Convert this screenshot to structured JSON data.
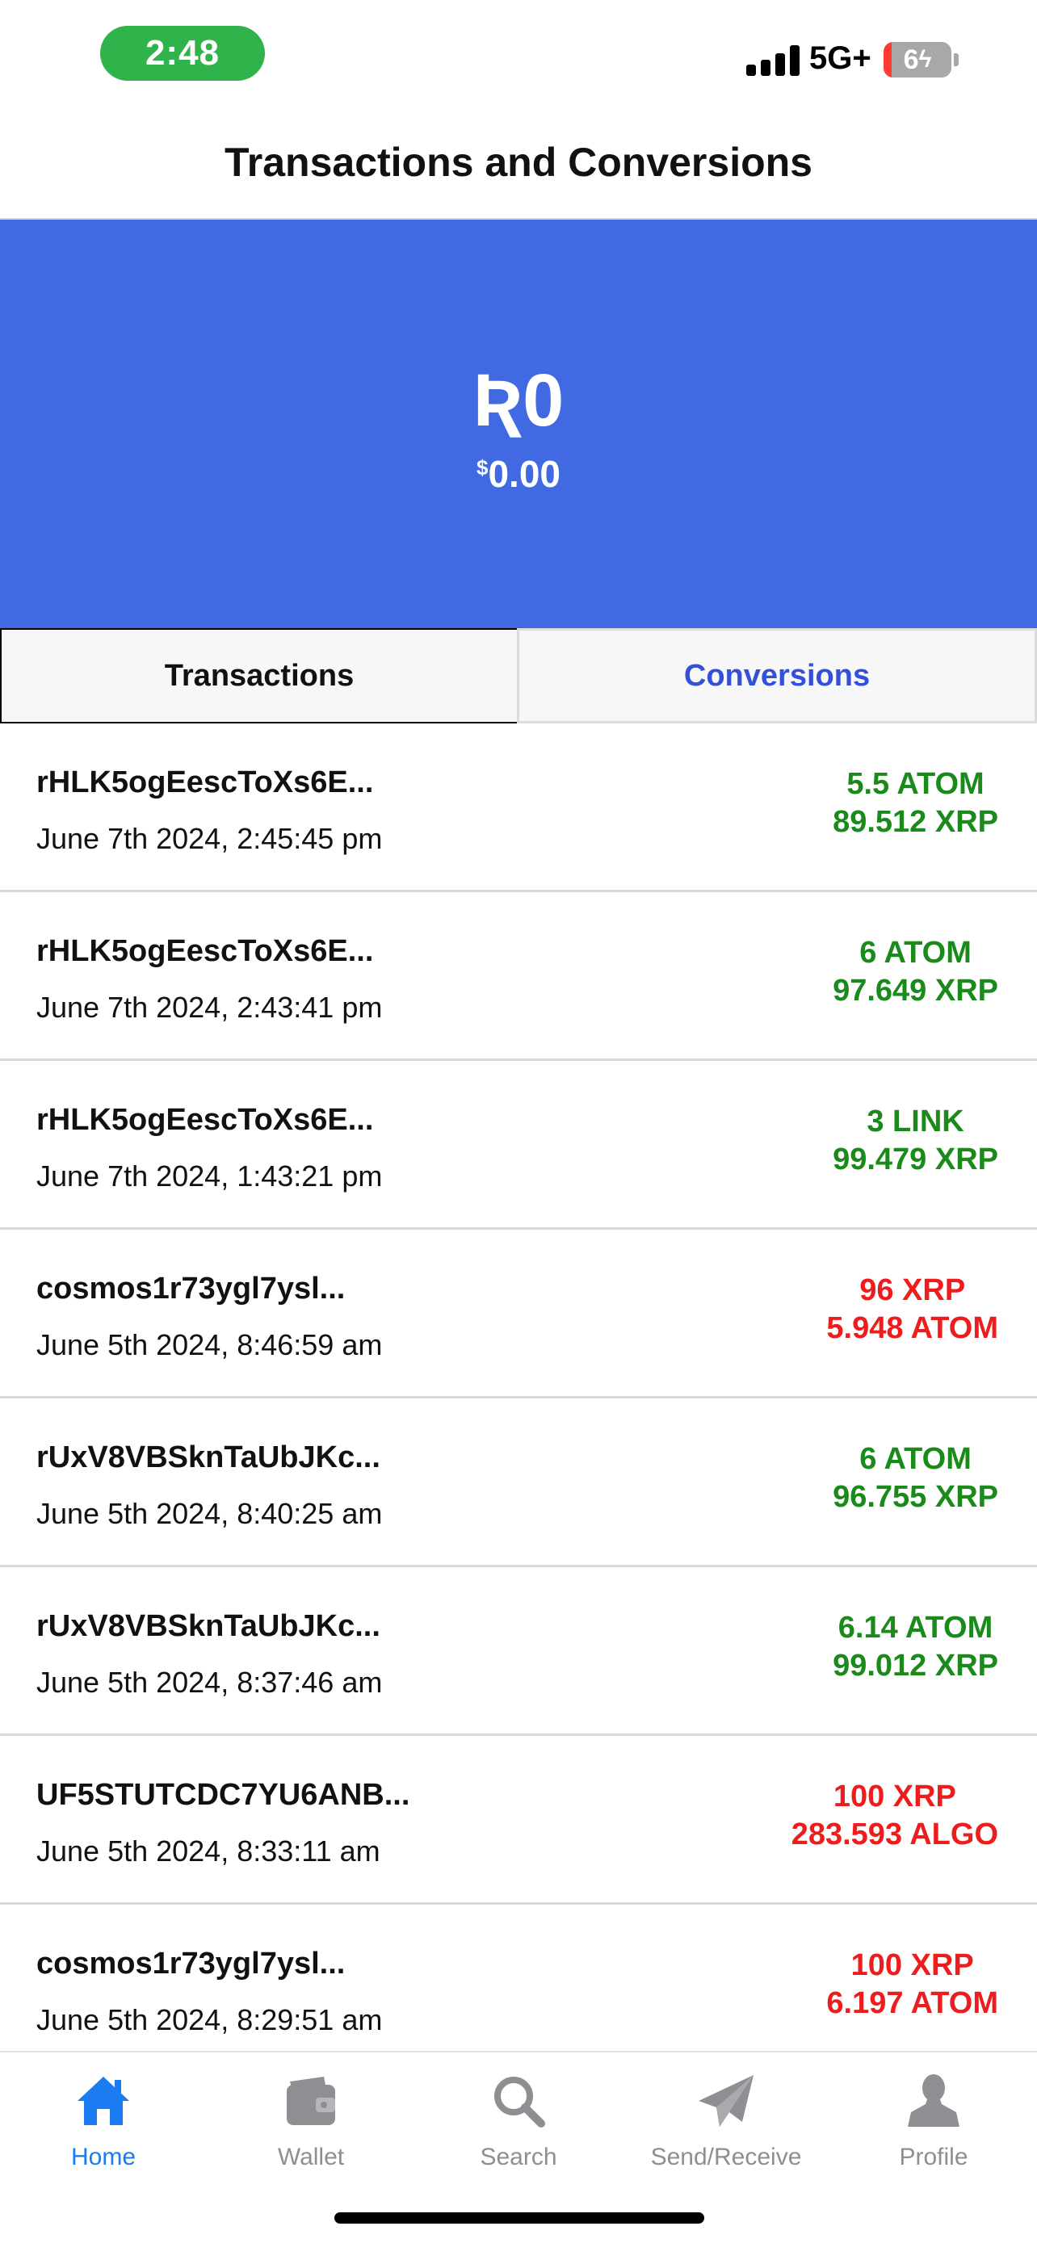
{
  "status_bar": {
    "time": "2:48",
    "network": "5G+",
    "battery": "6"
  },
  "header": {
    "title": "Transactions and Conversions"
  },
  "balance": {
    "symbol": "Ʀ",
    "amount": "0",
    "fiat_symbol": "$",
    "fiat_amount": "0.00"
  },
  "tabs": [
    {
      "label": "Transactions",
      "active": false
    },
    {
      "label": "Conversions",
      "active": true
    }
  ],
  "conversions": [
    {
      "address": "rHLK5ogEescToXs6E...",
      "date": "June 7th 2024, 2:45:45 pm",
      "amount_from": "5.5 ATOM",
      "amount_to": "89.512 XRP",
      "direction": "in"
    },
    {
      "address": "rHLK5ogEescToXs6E...",
      "date": "June 7th 2024, 2:43:41 pm",
      "amount_from": "6 ATOM",
      "amount_to": "97.649 XRP",
      "direction": "in"
    },
    {
      "address": "rHLK5ogEescToXs6E...",
      "date": "June 7th 2024, 1:43:21 pm",
      "amount_from": "3 LINK",
      "amount_to": "99.479 XRP",
      "direction": "in"
    },
    {
      "address": "cosmos1r73ygl7ysl...",
      "date": "June 5th 2024, 8:46:59 am",
      "amount_from": "96 XRP",
      "amount_to": "5.948 ATOM",
      "direction": "out"
    },
    {
      "address": "rUxV8VBSknTaUbJKc...",
      "date": "June 5th 2024, 8:40:25 am",
      "amount_from": "6 ATOM",
      "amount_to": "96.755 XRP",
      "direction": "in"
    },
    {
      "address": "rUxV8VBSknTaUbJKc...",
      "date": "June 5th 2024, 8:37:46 am",
      "amount_from": "6.14 ATOM",
      "amount_to": "99.012 XRP",
      "direction": "in"
    },
    {
      "address": "UF5STUTCDC7YU6ANB...",
      "date": "June 5th 2024, 8:33:11 am",
      "amount_from": "100 XRP",
      "amount_to": "283.593 ALGO",
      "direction": "out"
    },
    {
      "address": "cosmos1r73ygl7ysl...",
      "date": "June 5th 2024, 8:29:51 am",
      "amount_from": "100 XRP",
      "amount_to": "6.197 ATOM",
      "direction": "out"
    }
  ],
  "colors": {
    "accent": "#4169e1",
    "incoming": "#1a8a1a",
    "outgoing": "#ee1c1c",
    "active_tab": "#1a7cf0"
  },
  "nav": [
    {
      "label": "Home",
      "icon": "home-icon",
      "active": true
    },
    {
      "label": "Wallet",
      "icon": "wallet-icon",
      "active": false
    },
    {
      "label": "Search",
      "icon": "search-icon",
      "active": false
    },
    {
      "label": "Send/Receive",
      "icon": "send-icon",
      "active": false
    },
    {
      "label": "Profile",
      "icon": "profile-icon",
      "active": false
    }
  ]
}
